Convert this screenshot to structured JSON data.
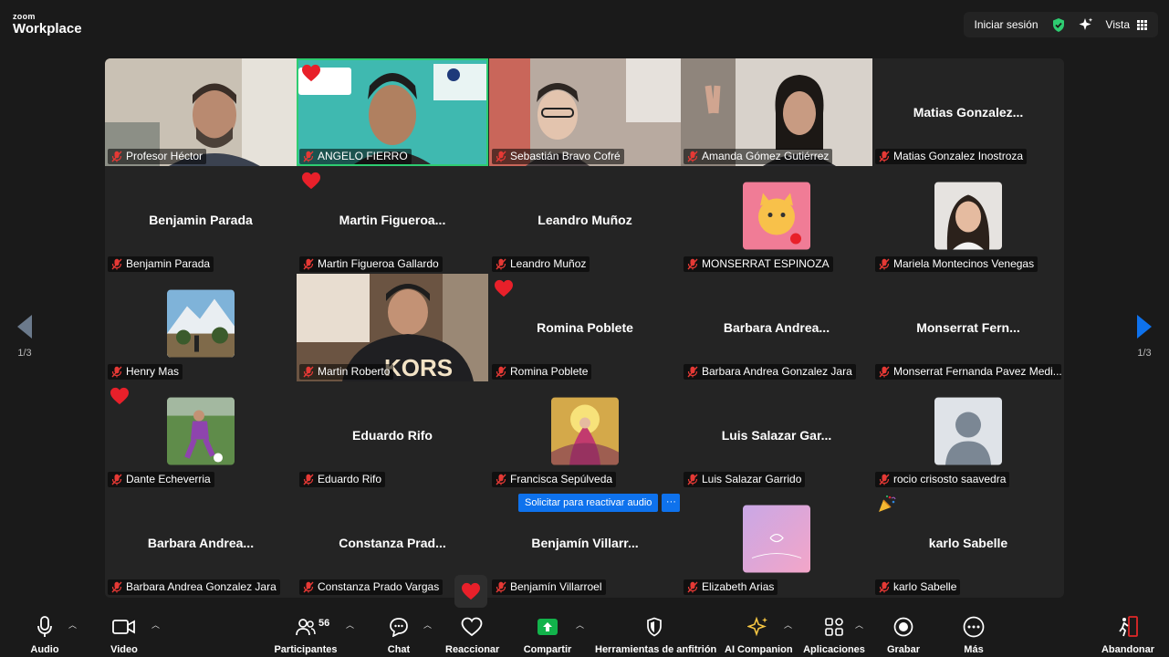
{
  "app": {
    "logo_small": "zoom",
    "logo_big": "Workplace"
  },
  "top_right": {
    "signin_label": "Iniciar sesión",
    "view_label": "Vista",
    "shield_color": "#2ecc71"
  },
  "pager": {
    "left_label": "1/3",
    "right_label": "1/3",
    "left_arrow_color": "#6b7a8c",
    "right_arrow_color": "#0e72ed"
  },
  "tiles": [
    {
      "display": "video",
      "tag": "Profesor Héctor"
    },
    {
      "display": "video",
      "tag": "ANGELO FIERRO",
      "active": true,
      "reaction": "heart-icon"
    },
    {
      "display": "video",
      "tag": "Sebastián Bravo Cofré"
    },
    {
      "display": "video",
      "tag": "Amanda Gómez Gutiérrez"
    },
    {
      "display": "name",
      "name": "Matias  Gonzalez...",
      "tag": "Matias Gonzalez Inostroza"
    },
    {
      "display": "name",
      "name": "Benjamin Parada",
      "tag": "Benjamin Parada"
    },
    {
      "display": "name",
      "name": "Martin  Figueroa...",
      "tag": "Martin Figueroa Gallardo",
      "reaction": "heart-icon"
    },
    {
      "display": "name",
      "name": "Leandro Muñoz",
      "tag": "Leandro Muñoz"
    },
    {
      "display": "avatar",
      "avatar": "cat-avatar",
      "tag": "MONSERRAT ESPINOZA"
    },
    {
      "display": "avatar",
      "avatar": "woman-avatar",
      "tag": "Mariela Montecinos Venegas"
    },
    {
      "display": "avatar",
      "avatar": "mountain-avatar",
      "tag": "Henry Mas"
    },
    {
      "display": "video",
      "tag": "Martin Roberto"
    },
    {
      "display": "name",
      "name": "Romina Poblete",
      "tag": "Romina Poblete",
      "reaction": "heart-icon"
    },
    {
      "display": "name",
      "name": "Barbara  Andrea...",
      "tag": "Barbara Andrea Gonzalez Jara"
    },
    {
      "display": "name",
      "name": "Monserrat  Fern...",
      "tag": "Monserrat Fernanda Pavez Medi..."
    },
    {
      "display": "avatar",
      "avatar": "soccer-avatar",
      "tag": "Dante Echeverria",
      "reaction": "heart-icon"
    },
    {
      "display": "name",
      "name": "Eduardo Rifo",
      "tag": "Eduardo Rifo"
    },
    {
      "display": "avatar",
      "avatar": "painting-avatar",
      "tag": "Francisca Sepúlveda"
    },
    {
      "display": "name",
      "name": "Luis  Salazar  Gar...",
      "tag": "Luis Salazar Garrido"
    },
    {
      "display": "avatar",
      "avatar": "default-user-avatar",
      "tag": "rocio crisosto saavedra"
    },
    {
      "display": "name",
      "name": "Barbara  Andrea...",
      "tag": "Barbara Andrea Gonzalez Jara"
    },
    {
      "display": "name",
      "name": "Constanza  Prad...",
      "tag": "Constanza Prado Vargas"
    },
    {
      "display": "name",
      "name": "Benjamín  Villarr...",
      "tag": "Benjamín Villarroel"
    },
    {
      "display": "avatar",
      "avatar": "pink-avatar",
      "tag": "Elizabeth Arias"
    },
    {
      "display": "name",
      "name": "karlo Sabelle",
      "tag": "karlo Sabelle",
      "reaction": "party-icon"
    }
  ],
  "unmute": {
    "label": "Solicitar para reactivar audio",
    "more": "···"
  },
  "toolbar": {
    "audio": "Audio",
    "video": "Video",
    "participants": "Participantes",
    "participants_count": "56",
    "chat": "Chat",
    "react": "Reaccionar",
    "share": "Compartir",
    "host_tools": "Herramientas de anfitrión",
    "ai": "AI Companion",
    "apps": "Aplicaciones",
    "record": "Grabar",
    "more": "Más",
    "leave": "Abandonar",
    "share_color": "#12b34b",
    "leave_color": "#e02828"
  }
}
